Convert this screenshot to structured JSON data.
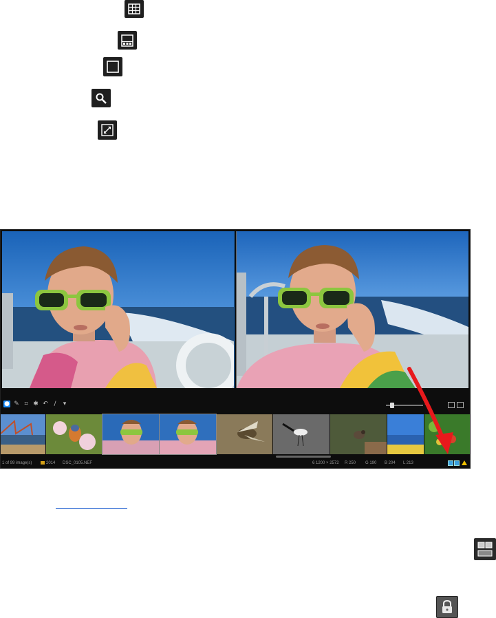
{
  "icons": {
    "grid": "grid-view-icon",
    "filmstrip": "filmstrip-view-icon",
    "single": "single-view-icon",
    "magnifier": "magnifier-icon",
    "fullscreen": "fullscreen-icon",
    "compare": "compare-view-icon",
    "lock": "lock-icon"
  },
  "app": {
    "zoom_label": "...",
    "status": {
      "image_count": "1 of 99 image(s)",
      "folder": "2014",
      "filename": "DSC_0105.NEF",
      "dimensions": "6 1200 × 2572",
      "r": "R  250",
      "g": "G  190",
      "b": "B  204",
      "l": "L  213"
    },
    "thumbnails": [
      "bridge-thumbnail",
      "bird-blossom-thumbnail",
      "boy-sunglasses-thumbnail-1",
      "boy-sunglasses-thumbnail-2",
      "duck-flying-thumbnail",
      "bird-water-thumbnail",
      "small-bird-thumbnail",
      "lake-sky-thumbnail",
      "flowers-thumbnail"
    ]
  },
  "colors": {
    "accent": "#1e90ff",
    "arrow": "#e8191c",
    "link": "#1155cc"
  }
}
